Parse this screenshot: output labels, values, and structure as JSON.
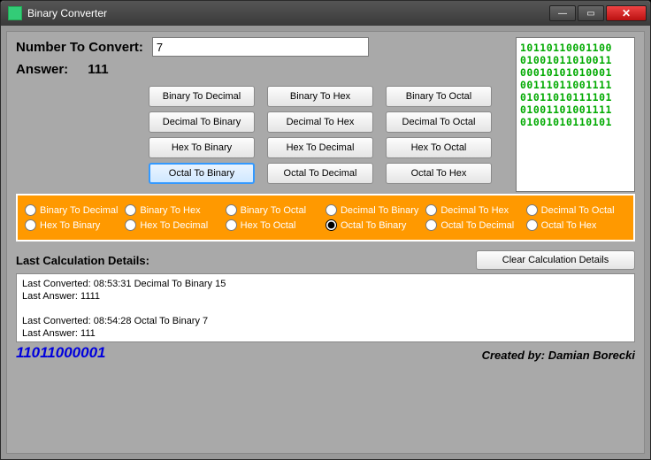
{
  "window_title": "Binary Converter",
  "input_label": "Number To Convert:",
  "input_value": "7",
  "answer_label": "Answer:",
  "answer_value": "111",
  "buttons": [
    [
      "Binary To Decimal",
      "Binary To Hex",
      "Binary To Octal"
    ],
    [
      "Decimal To Binary",
      "Decimal To Hex",
      "Decimal To Octal"
    ],
    [
      "Hex To Binary",
      "Hex To Decimal",
      "Hex To Octal"
    ],
    [
      "Octal To Binary",
      "Octal To Decimal",
      "Octal To Hex"
    ]
  ],
  "selected_button": "Octal To Binary",
  "bin_art": "10110110001100\n01001011010011\n00010101010001\n00111011001111\n01011010111101\n01001101001111\n01001010110101",
  "radios_top": [
    "Binary To Decimal",
    "Binary To Hex",
    "Binary To Octal",
    "Decimal To Binary",
    "Decimal To Hex",
    "Decimal To Octal"
  ],
  "radios_bottom": [
    "Hex To Binary",
    "Hex To Decimal",
    "Hex To Octal",
    "Octal To Binary",
    "Octal To Decimal",
    "Octal To Hex"
  ],
  "selected_radio": "Octal To Binary",
  "details_title": "Last Calculation Details:",
  "clear_label": "Clear Calculation Details",
  "details_text": "Last Converted: 08:53:31  Decimal To Binary 15\nLast Answer: 1111\n\nLast Converted: 08:54:28  Octal To Binary 7\nLast Answer: 111",
  "footer_num": "11011000001",
  "credit": "Created by: Damian Borecki"
}
